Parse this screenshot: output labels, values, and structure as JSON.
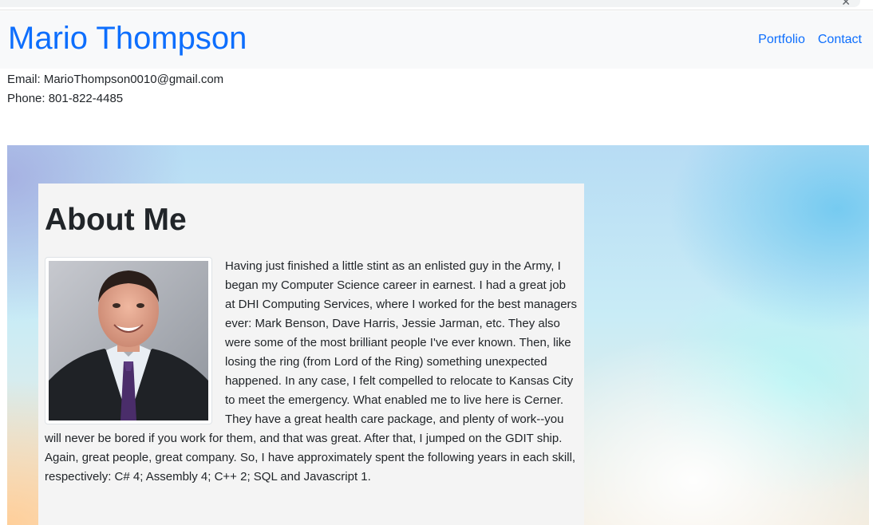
{
  "navbar": {
    "brand": "Mario Thompson",
    "links": [
      "Portfolio",
      "Contact"
    ]
  },
  "contact": {
    "email_line": "Email: MarioThompson0010@gmail.com",
    "phone_line": "Phone: 801-822-4485"
  },
  "about": {
    "heading": "About Me",
    "photo_alt": "Photo of Mario Thompson",
    "paragraph": "Having just finished a little stint as an enlisted guy in the Army, I began my Computer Science career in earnest. I had a great job at DHI Computing Services, where I worked for the best managers ever: Mark Benson, Dave Harris, Jessie Jarman, etc. They also were some of the most brilliant people I've ever known. Then, like losing the ring (from Lord of the Ring) something unexpected happened. In any case, I felt compelled to relocate to Kansas City to meet the emergency. What enabled me to live here is Cerner. They have a great health care package, and plenty of work--you will never be bored if you work for them, and that was great. After that, I jumped on the GDIT ship. Again, great people, great company. So, I have approximately spent the following years in each skill, respectively: C# 4; Assembly 4; C++ 2; SQL and Javascript 1."
  },
  "colors": {
    "brand": "#0d6efd",
    "navbar_bg": "#f8f9fa",
    "card_bg": "#f4f4f4"
  },
  "icons": {
    "close": "close-icon"
  }
}
